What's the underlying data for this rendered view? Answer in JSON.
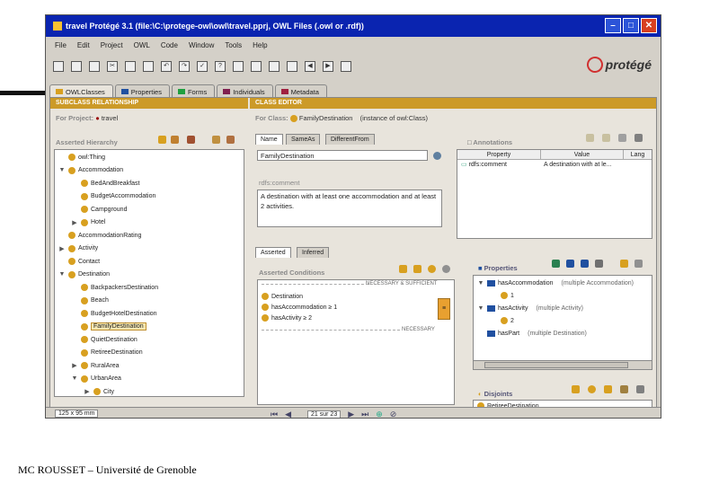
{
  "window": {
    "title": "travel Protégé 3.1    (file:\\C:\\protege-owl\\owl\\travel.pprj, OWL Files (.owl or .rdf))"
  },
  "menu": [
    "File",
    "Edit",
    "Project",
    "OWL",
    "Code",
    "Window",
    "Tools",
    "Help"
  ],
  "logo_text": "protégé",
  "tabs": [
    {
      "label": "OWLClasses",
      "icon": "owl-classes-icon",
      "color": "#d8a020"
    },
    {
      "label": "Properties",
      "icon": "properties-icon",
      "color": "#2050a0"
    },
    {
      "label": "Forms",
      "icon": "forms-icon",
      "color": "#20a040"
    },
    {
      "label": "Individuals",
      "icon": "individuals-icon",
      "color": "#802050"
    },
    {
      "label": "Metadata",
      "icon": "metadata-icon",
      "color": "#a02040"
    }
  ],
  "left": {
    "header": "SUBCLASS RELATIONSHIP",
    "for_project_label": "For Project:",
    "project_name": "travel",
    "hierarchy_label": "Asserted Hierarchy",
    "tree": [
      {
        "label": "owl:Thing",
        "depth": 0,
        "expander": ""
      },
      {
        "label": "Accommodation",
        "depth": 0,
        "expander": "▼"
      },
      {
        "label": "BedAndBreakfast",
        "depth": 1,
        "expander": ""
      },
      {
        "label": "BudgetAccommodation",
        "depth": 1,
        "expander": ""
      },
      {
        "label": "Campground",
        "depth": 1,
        "expander": ""
      },
      {
        "label": "Hotel",
        "depth": 1,
        "expander": "▶"
      },
      {
        "label": "AccommodationRating",
        "depth": 0,
        "expander": ""
      },
      {
        "label": "Activity",
        "depth": 0,
        "expander": "▶"
      },
      {
        "label": "Contact",
        "depth": 0,
        "expander": ""
      },
      {
        "label": "Destination",
        "depth": 0,
        "expander": "▼"
      },
      {
        "label": "BackpackersDestination",
        "depth": 1,
        "expander": ""
      },
      {
        "label": "Beach",
        "depth": 1,
        "expander": ""
      },
      {
        "label": "BudgetHotelDestination",
        "depth": 1,
        "expander": ""
      },
      {
        "label": "FamilyDestination",
        "depth": 1,
        "expander": "",
        "selected": true
      },
      {
        "label": "QuietDestination",
        "depth": 1,
        "expander": ""
      },
      {
        "label": "RetireeDestination",
        "depth": 1,
        "expander": ""
      },
      {
        "label": "RuralArea",
        "depth": 1,
        "expander": "▶"
      },
      {
        "label": "UrbanArea",
        "depth": 1,
        "expander": "▼"
      },
      {
        "label": "City",
        "depth": 2,
        "expander": "▶"
      }
    ]
  },
  "editor": {
    "header": "CLASS EDITOR",
    "for_class_label": "For Class:",
    "class_name": "FamilyDestination",
    "instance_of": "(instance of owl:Class)",
    "subtabs": [
      "Name",
      "SameAs",
      "DifferentFrom"
    ],
    "name_value": "FamilyDestination",
    "comment_label": "rdfs:comment",
    "comment_text": "A destination with at least one accommodation and at least 2 activities.",
    "annotations": {
      "label": "Annotations",
      "columns": [
        "Property",
        "Value",
        "Lang"
      ],
      "rows": [
        {
          "property": "rdfs:comment",
          "value": "A destination with at le...",
          "lang": ""
        }
      ]
    },
    "cond_tabs": [
      "Asserted",
      "Inferred"
    ],
    "conditions_label": "Asserted Conditions",
    "necessary_sufficient": "NECESSARY & SUFFICIENT",
    "necessary": "NECESSARY",
    "conditions": [
      "Destination",
      "hasAccommodation ≥ 1",
      "hasActivity ≥ 2"
    ],
    "properties": {
      "label": "Properties",
      "rows": [
        {
          "name": "hasAccommodation",
          "range": "(multiple Accommodation)",
          "sub": "1"
        },
        {
          "name": "hasActivity",
          "range": "(multiple Activity)",
          "sub": "2"
        },
        {
          "name": "hasPart",
          "range": "(multiple Destination)",
          "sub": ""
        }
      ]
    },
    "disjoints": {
      "label": "Disjoints",
      "rows": [
        "RetireeDestination"
      ]
    }
  },
  "status": {
    "zoom": "125 x 95 mm",
    "page": "21 sur 23"
  },
  "footer": "MC ROUSSET – Université de Grenoble"
}
